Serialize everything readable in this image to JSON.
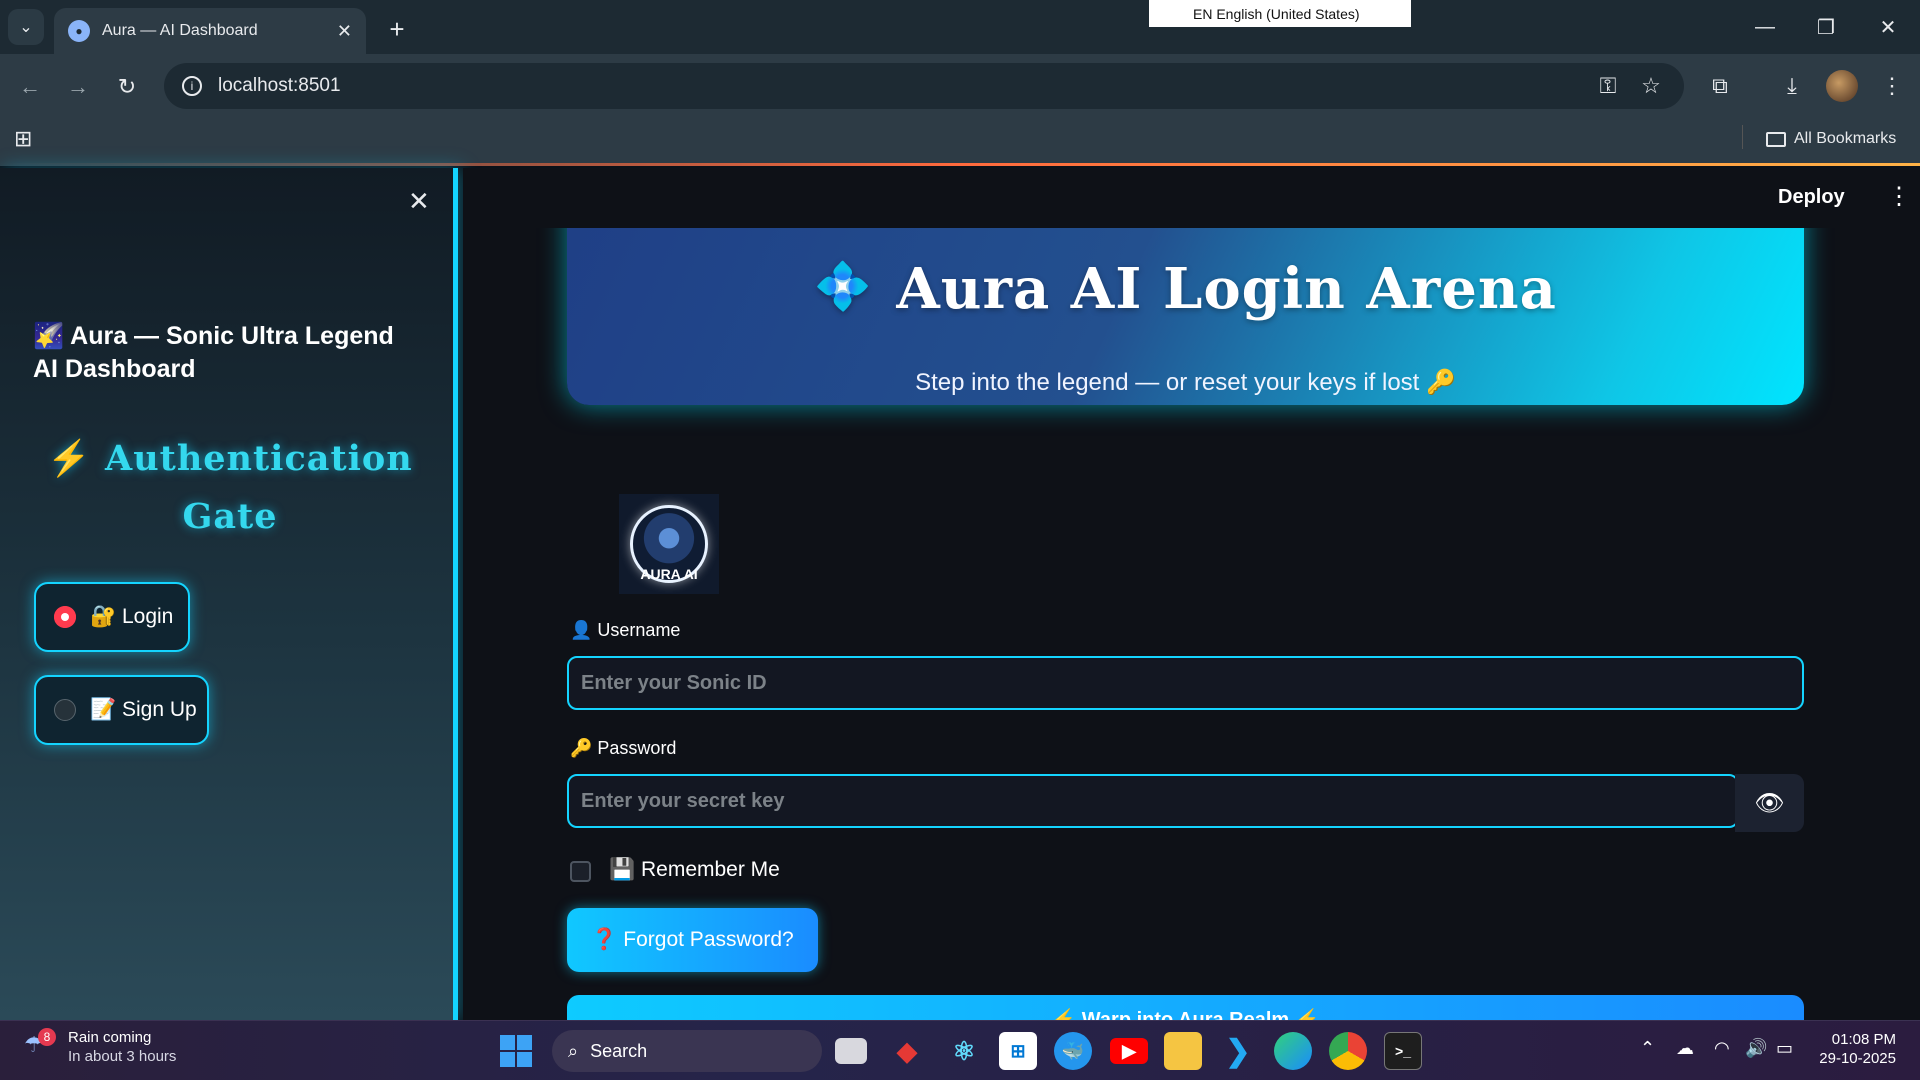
{
  "browser": {
    "tab_title": "Aura — AI Dashboard",
    "url": "localhost:8501",
    "ime_label": "EN English (United States)",
    "bookmarks_label": "All Bookmarks"
  },
  "sidebar": {
    "title": "🌠 Aura — Sonic Ultra Legend AI Dashboard",
    "gate_title": "⚡ Authentication Gate",
    "options": [
      {
        "label": "🔐 Login",
        "selected": true
      },
      {
        "label": "📝 Sign Up",
        "selected": false
      }
    ]
  },
  "header": {
    "deploy_label": "Deploy"
  },
  "hero": {
    "icon": "💠",
    "title": "Aura AI Login Arena",
    "subtitle": "Step into the legend — or reset your keys if lost 🔑"
  },
  "logo": {
    "text": "AURA AI"
  },
  "form": {
    "username_label": "👤 Username",
    "username_placeholder": "Enter your Sonic ID",
    "password_label": "🔑 Password",
    "password_placeholder": "Enter your secret key",
    "remember_label": "💾 Remember Me",
    "forgot_label": "❓ Forgot Password?",
    "warp_label": "⚡ Warp into Aura Realm ⚡"
  },
  "taskbar": {
    "weather_title": "Rain coming",
    "weather_sub": "In about 3 hours",
    "weather_badge": "8",
    "search_label": "Search",
    "time": "01:08 PM",
    "date": "29-10-2025"
  },
  "colors": {
    "accent": "#14d4ff",
    "gate_text": "#34d8ee",
    "radio_selected": "#ff3b4e"
  }
}
